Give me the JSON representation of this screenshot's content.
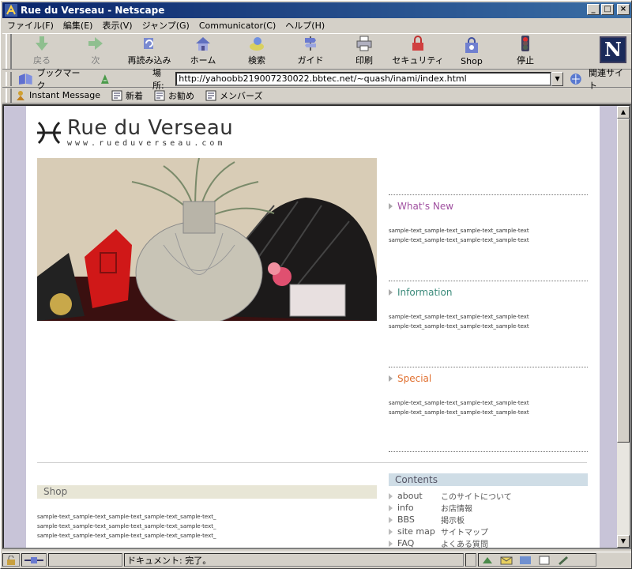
{
  "window": {
    "title": "Rue du Verseau - Netscape",
    "min": "_",
    "max": "□",
    "close": "×"
  },
  "menu": [
    "ファイル(F)",
    "編集(E)",
    "表示(V)",
    "ジャンプ(G)",
    "Communicator(C)",
    "ヘルプ(H)"
  ],
  "toolbar": {
    "back": "戻る",
    "forward": "次",
    "reload": "再読み込み",
    "home": "ホーム",
    "search": "検索",
    "guide": "ガイド",
    "print": "印刷",
    "security": "セキュリティ",
    "shop": "Shop",
    "stop": "停止",
    "logo": "N"
  },
  "location": {
    "bookmarks": "ブックマーク",
    "label": "場所:",
    "url": "http://yahoobb219007230022.bbtec.net/~quash/inami/index.html",
    "related": "関連サイト"
  },
  "personal": [
    "Instant Message",
    "新着",
    "お勧め",
    "メンバーズ"
  ],
  "site": {
    "name": "Rue du Verseau",
    "url": "www.rueduverseau.com",
    "sections": [
      {
        "title": "What's New",
        "color": "#a050a0",
        "lines": [
          "sample-text_sample-text_sample-text_sample-text",
          "sample-text_sample-text_sample-text_sample-text"
        ]
      },
      {
        "title": "Information",
        "color": "#3a8a7a",
        "lines": [
          "sample-text_sample-text_sample-text_sample-text",
          "sample-text_sample-text_sample-text_sample-text"
        ]
      },
      {
        "title": "Special",
        "color": "#e07030",
        "lines": [
          "sample-text_sample-text_sample-text_sample-text",
          "sample-text_sample-text_sample-text_sample-text"
        ]
      }
    ],
    "shop": {
      "title": "Shop",
      "lines": [
        "sample-text_sample-text_sample-text_sample-text_sample-text_",
        "sample-text_sample-text_sample-text_sample-text_sample-text_",
        "sample-text_sample-text_sample-text_sample-text_sample-text_"
      ]
    },
    "contents": {
      "title": "Contents",
      "items": [
        {
          "key": "about",
          "value": "このサイトについて"
        },
        {
          "key": "info",
          "value": "お店情報"
        },
        {
          "key": "BBS",
          "value": "掲示板"
        },
        {
          "key": "site map",
          "value": "サイトマップ"
        },
        {
          "key": "FAQ",
          "value": "よくある質問"
        }
      ]
    }
  },
  "status": {
    "text": "ドキュメント: 完了。"
  }
}
